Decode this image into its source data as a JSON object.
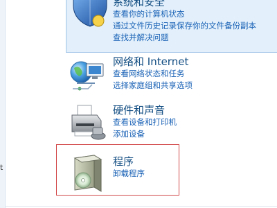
{
  "left_pane": {
    "fragment": "t"
  },
  "categories": [
    {
      "title": "系统和安全",
      "links": [
        "查看你的计算机状态",
        "通过文件历史记录保存你的文件备份副本",
        "查找并解决问题"
      ]
    },
    {
      "title": "网络和 Internet",
      "links": [
        "查看网络状态和任务",
        "选择家庭组和共享选项"
      ]
    },
    {
      "title": "硬件和声音",
      "links": [
        "查看设备和打印机",
        "添加设备"
      ]
    },
    {
      "title": "程序",
      "links": [
        "卸载程序"
      ]
    }
  ],
  "colors": {
    "title": "#124d82",
    "link": "#1a62b6",
    "highlight": "#e3f0fb",
    "red_box": "#d24848"
  },
  "icons": {
    "security": "shield-icon",
    "network": "network-globe-icon",
    "hardware": "printer-icon",
    "programs": "software-box-icon"
  }
}
